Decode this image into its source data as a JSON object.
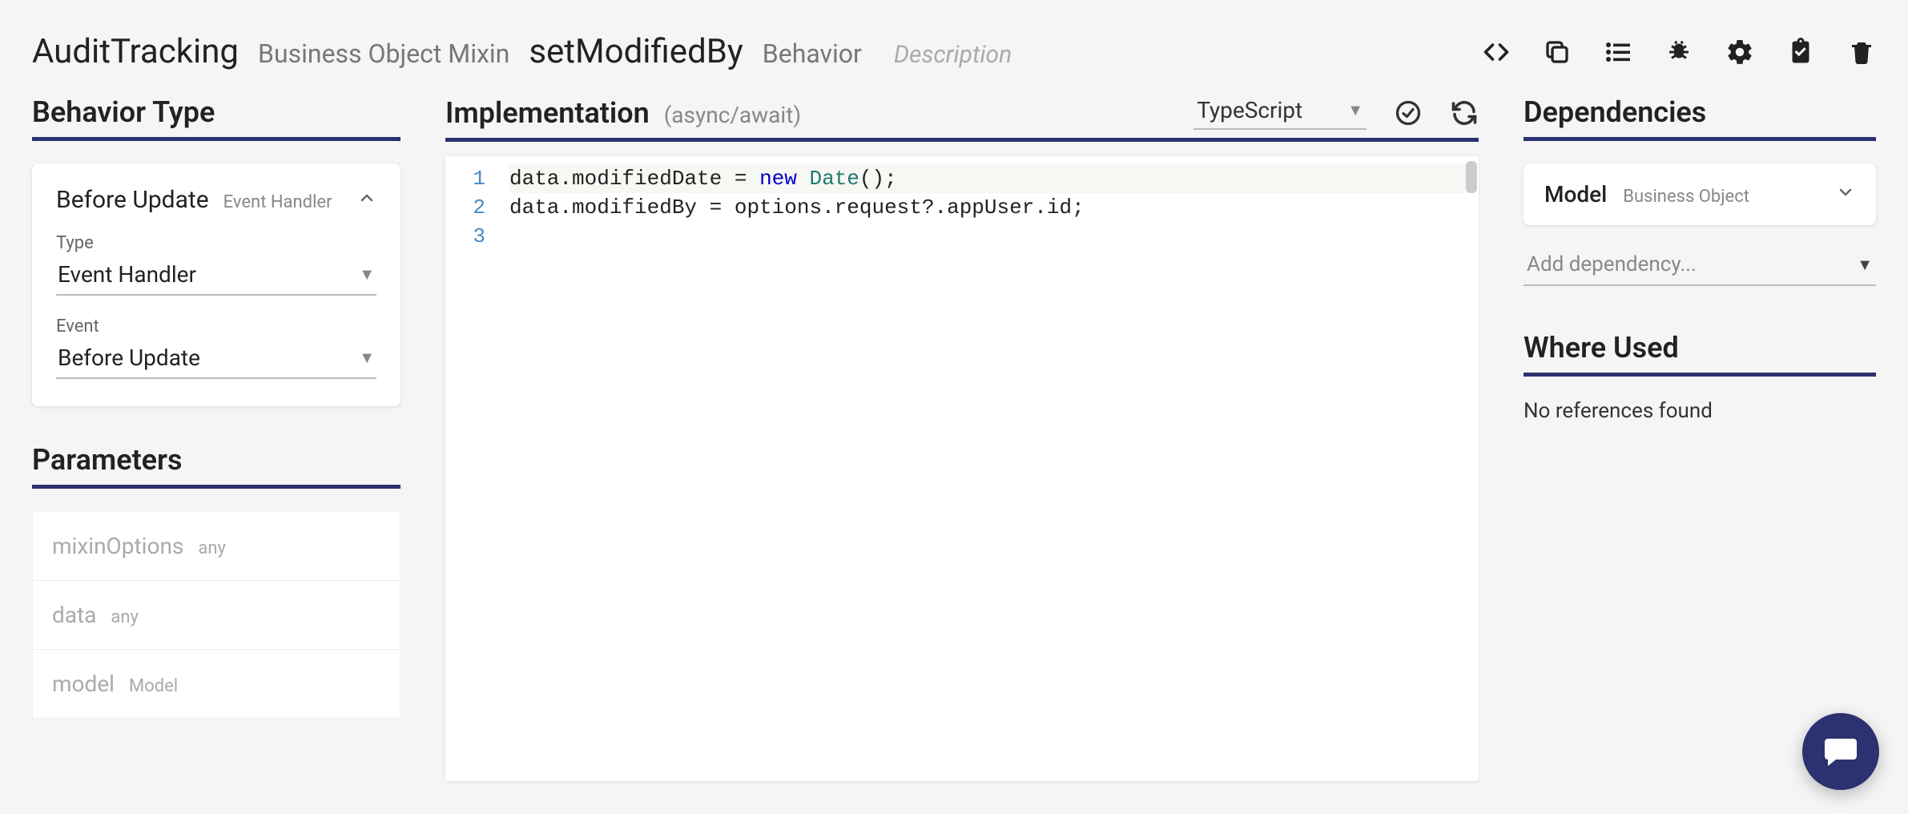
{
  "header": {
    "entity_name": "AuditTracking",
    "entity_type": "Business Object Mixin",
    "behavior_name": "setModifiedBy",
    "behavior_kind": "Behavior",
    "description_placeholder": "Description"
  },
  "toolbar": {
    "icons": [
      "code",
      "copy",
      "list",
      "bug",
      "settings",
      "task",
      "delete"
    ]
  },
  "behavior_type": {
    "section_title": "Behavior Type",
    "card_title": "Before Update",
    "card_tag": "Event Handler",
    "type_label": "Type",
    "type_value": "Event Handler",
    "event_label": "Event",
    "event_value": "Before Update"
  },
  "parameters": {
    "section_title": "Parameters",
    "items": [
      {
        "name": "mixinOptions",
        "type": "any"
      },
      {
        "name": "data",
        "type": "any"
      },
      {
        "name": "model",
        "type": "Model"
      }
    ]
  },
  "implementation": {
    "section_title": "Implementation",
    "mode": "(async/await)",
    "language": "TypeScript",
    "code_lines": [
      {
        "n": 1,
        "segments": [
          {
            "t": "data.modifiedDate = ",
            "c": ""
          },
          {
            "t": "new",
            "c": "kw"
          },
          {
            "t": " ",
            "c": ""
          },
          {
            "t": "Date",
            "c": "fn"
          },
          {
            "t": "();",
            "c": ""
          }
        ]
      },
      {
        "n": 2,
        "segments": [
          {
            "t": "data.modifiedBy = options.request?.appUser.id;",
            "c": ""
          }
        ]
      },
      {
        "n": 3,
        "segments": []
      }
    ]
  },
  "dependencies": {
    "section_title": "Dependencies",
    "items": [
      {
        "name": "Model",
        "type": "Business Object"
      }
    ],
    "add_placeholder": "Add dependency..."
  },
  "where_used": {
    "section_title": "Where Used",
    "empty_text": "No references found"
  }
}
